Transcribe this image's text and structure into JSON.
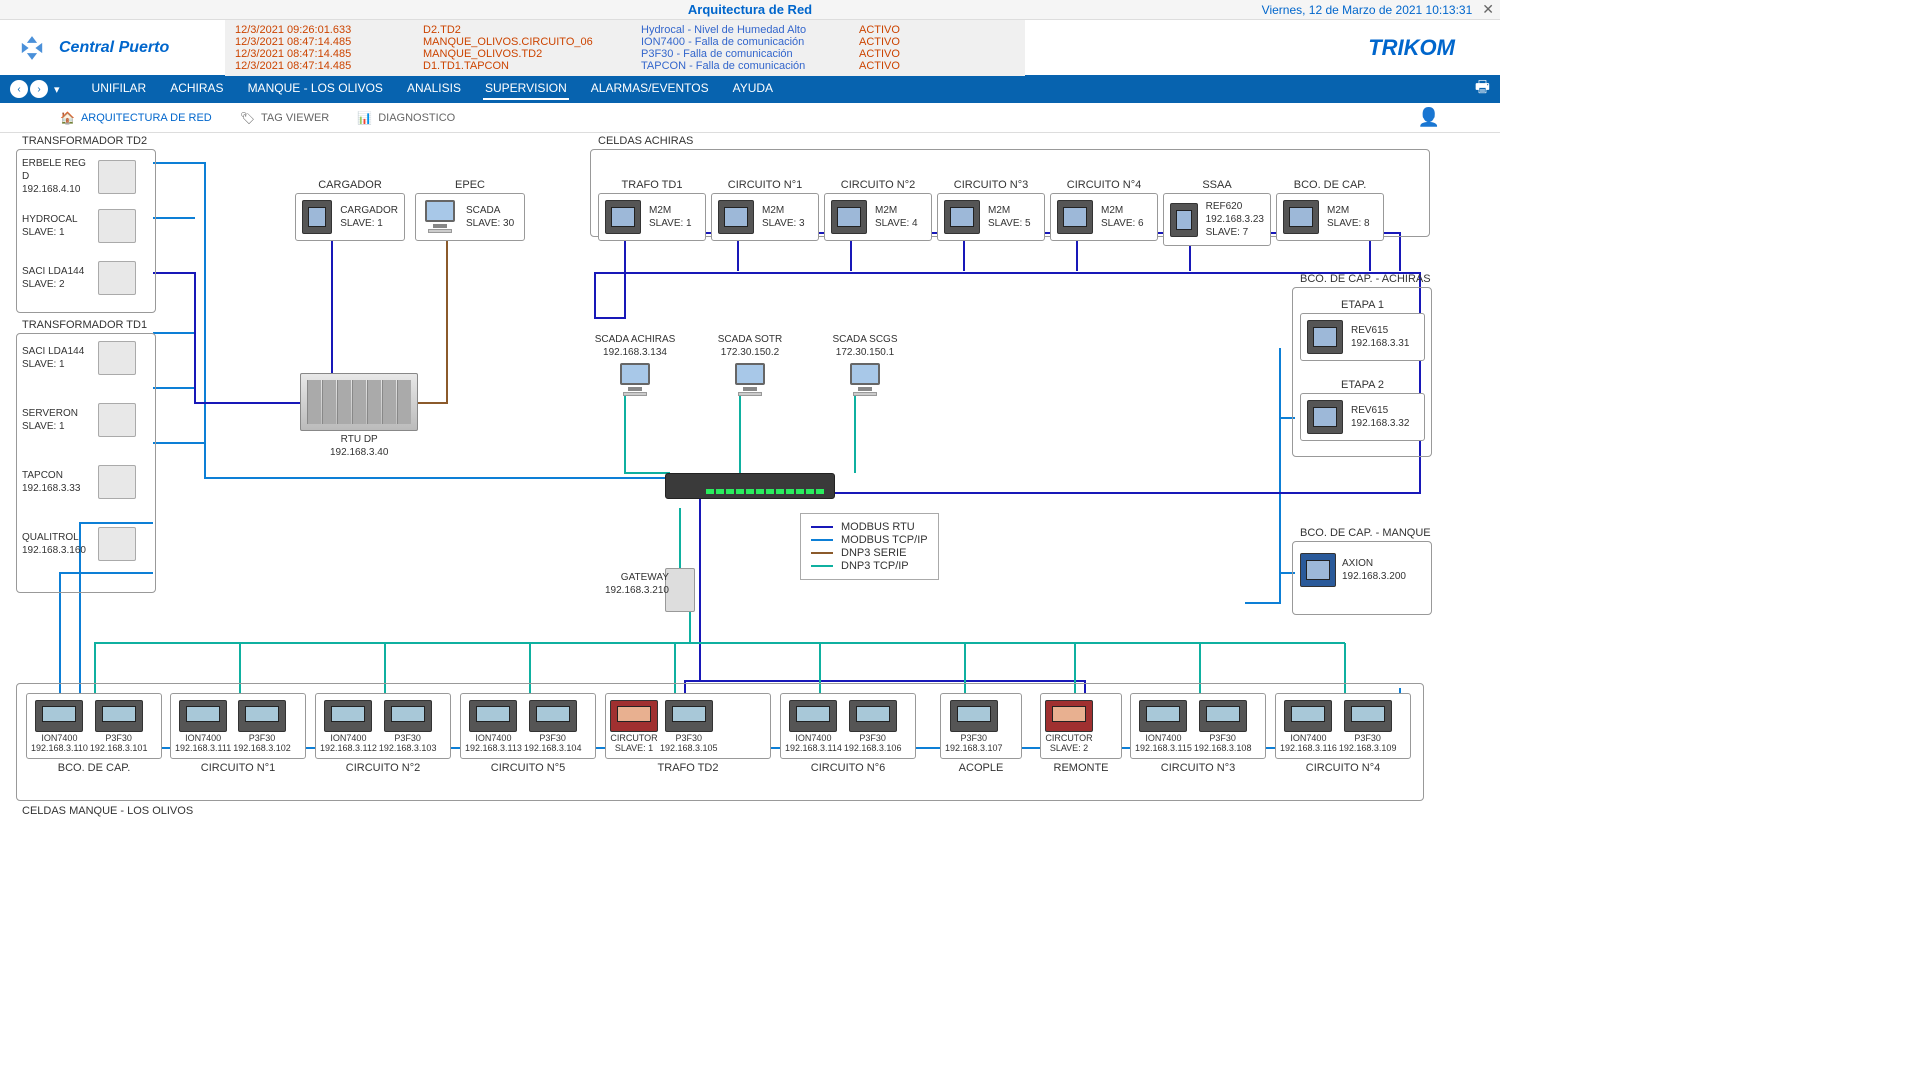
{
  "title": "Arquitectura de Red",
  "datetime": "Viernes, 12 de Marzo de 2021 10:13:31",
  "logo_text": "Central Puerto",
  "brand": "TRIKOM",
  "alarms": [
    {
      "ts": "12/3/2021 09:26:01.633",
      "src": "D2.TD2",
      "msg": "Hydrocal - Nivel de Humedad Alto",
      "status": "ACTIVO"
    },
    {
      "ts": "12/3/2021 08:47:14.485",
      "src": "MANQUE_OLIVOS.CIRCUITO_06",
      "msg": "ION7400 - Falla de comunicación",
      "status": "ACTIVO"
    },
    {
      "ts": "12/3/2021 08:47:14.485",
      "src": "MANQUE_OLIVOS.TD2",
      "msg": "P3F30 - Falla de comunicación",
      "status": "ACTIVO"
    },
    {
      "ts": "12/3/2021 08:47:14.485",
      "src": "D1.TD1.TAPCON",
      "msg": "TAPCON - Falla de comunicación",
      "status": "ACTIVO"
    }
  ],
  "nav": [
    "UNIFILAR",
    "ACHIRAS",
    "MANQUE - LOS OLIVOS",
    "ANALISIS",
    "SUPERVISION",
    "ALARMAS/EVENTOS",
    "AYUDA"
  ],
  "nav_active": 4,
  "tabs": [
    {
      "icon": "🏠",
      "label": "ARQUITECTURA DE RED",
      "active": true
    },
    {
      "icon": "🏷",
      "label": "TAG VIEWER",
      "active": false
    },
    {
      "icon": "📊",
      "label": "DIAGNOSTICO",
      "active": false
    }
  ],
  "groups": {
    "td2": {
      "title": "TRANSFORMADOR TD2",
      "devices": [
        {
          "name": "ERBELE REG D",
          "addr": "192.168.4.10"
        },
        {
          "name": "HYDROCAL",
          "addr": "SLAVE: 1"
        },
        {
          "name": "SACI LDA144",
          "addr": "SLAVE: 2"
        }
      ]
    },
    "td1": {
      "title": "TRANSFORMADOR TD1",
      "devices": [
        {
          "name": "SACI LDA144",
          "addr": "SLAVE: 1"
        },
        {
          "name": "SERVERON",
          "addr": "SLAVE: 1"
        },
        {
          "name": "TAPCON",
          "addr": "192.168.3.33"
        },
        {
          "name": "QUALITROL",
          "addr": "192.168.3.160"
        }
      ]
    },
    "cargador": {
      "title": "CARGADOR",
      "name": "CARGADOR",
      "addr": "SLAVE: 1"
    },
    "epec": {
      "title": "EPEC",
      "name": "SCADA",
      "addr": "SLAVE: 30"
    },
    "achiras": {
      "title": "CELDAS ACHIRAS",
      "cells": [
        {
          "title": "TRAFO TD1",
          "name": "M2M",
          "addr": "SLAVE: 1"
        },
        {
          "title": "CIRCUITO N°1",
          "name": "M2M",
          "addr": "SLAVE: 3"
        },
        {
          "title": "CIRCUITO N°2",
          "name": "M2M",
          "addr": "SLAVE: 4"
        },
        {
          "title": "CIRCUITO N°3",
          "name": "M2M",
          "addr": "SLAVE: 5"
        },
        {
          "title": "CIRCUITO N°4",
          "name": "M2M",
          "addr": "SLAVE: 6"
        },
        {
          "title": "SSAA",
          "name": "REF620",
          "addr": "192.168.3.23",
          "addr2": "SLAVE: 7"
        },
        {
          "title": "BCO. DE CAP.",
          "name": "M2M",
          "addr": "SLAVE: 8"
        }
      ]
    },
    "scadas": [
      {
        "name": "SCADA ACHIRAS",
        "addr": "192.168.3.134"
      },
      {
        "name": "SCADA SOTR",
        "addr": "172.30.150.2"
      },
      {
        "name": "SCADA SCGS",
        "addr": "172.30.150.1"
      }
    ],
    "rtu": {
      "name": "RTU DP",
      "addr": "192.168.3.40"
    },
    "gateway": {
      "name": "GATEWAY",
      "addr": "192.168.3.210"
    },
    "bco_achiras": {
      "title": "BCO. DE CAP. - ACHIRAS",
      "cells": [
        {
          "title": "ETAPA 1",
          "name": "REV615",
          "addr": "192.168.3.31"
        },
        {
          "title": "ETAPA 2",
          "name": "REV615",
          "addr": "192.168.3.32"
        }
      ]
    },
    "bco_manque": {
      "title": "BCO. DE CAP. - MANQUE",
      "name": "AXION",
      "addr": "192.168.3.200"
    },
    "bottom_title": "CELDAS MANQUE - LOS OLIVOS",
    "bottom_cells": [
      {
        "title": "BCO. DE CAP.",
        "devs": [
          {
            "n": "ION7400",
            "a": "192.168.3.110"
          },
          {
            "n": "P3F30",
            "a": "192.168.3.101"
          }
        ]
      },
      {
        "title": "CIRCUITO N°1",
        "devs": [
          {
            "n": "ION7400",
            "a": "192.168.3.111"
          },
          {
            "n": "P3F30",
            "a": "192.168.3.102"
          }
        ]
      },
      {
        "title": "CIRCUITO N°2",
        "devs": [
          {
            "n": "ION7400",
            "a": "192.168.3.112"
          },
          {
            "n": "P3F30",
            "a": "192.168.3.103"
          }
        ]
      },
      {
        "title": "CIRCUITO N°5",
        "devs": [
          {
            "n": "ION7400",
            "a": "192.168.3.113"
          },
          {
            "n": "P3F30",
            "a": "192.168.3.104"
          }
        ]
      },
      {
        "title": "TRAFO TD2",
        "devs": [
          {
            "n": "CIRCUTOR",
            "a": "SLAVE: 1",
            "red": true
          },
          {
            "n": "P3F30",
            "a": "192.168.3.105"
          }
        ]
      },
      {
        "title": "CIRCUITO N°6",
        "devs": [
          {
            "n": "ION7400",
            "a": "192.168.3.114"
          },
          {
            "n": "P3F30",
            "a": "192.168.3.106"
          }
        ]
      },
      {
        "title": "ACOPLE",
        "devs": [
          {
            "n": "P3F30",
            "a": "192.168.3.107"
          }
        ]
      },
      {
        "title": "REMONTE",
        "devs": [
          {
            "n": "CIRCUTOR",
            "a": "SLAVE: 2",
            "red": true
          }
        ]
      },
      {
        "title": "CIRCUITO N°3",
        "devs": [
          {
            "n": "ION7400",
            "a": "192.168.3.115"
          },
          {
            "n": "P3F30",
            "a": "192.168.3.108"
          }
        ]
      },
      {
        "title": "CIRCUITO N°4",
        "devs": [
          {
            "n": "ION7400",
            "a": "192.168.3.116"
          },
          {
            "n": "P3F30",
            "a": "192.168.3.109"
          }
        ]
      }
    ]
  },
  "legend": [
    {
      "label": "MODBUS RTU",
      "color": "#1818b8"
    },
    {
      "label": "MODBUS TCP/IP",
      "color": "#0d7fd6"
    },
    {
      "label": "DNP3 SERIE",
      "color": "#8b5a2b"
    },
    {
      "label": "DNP3 TCP/IP",
      "color": "#0fb0a0"
    }
  ]
}
